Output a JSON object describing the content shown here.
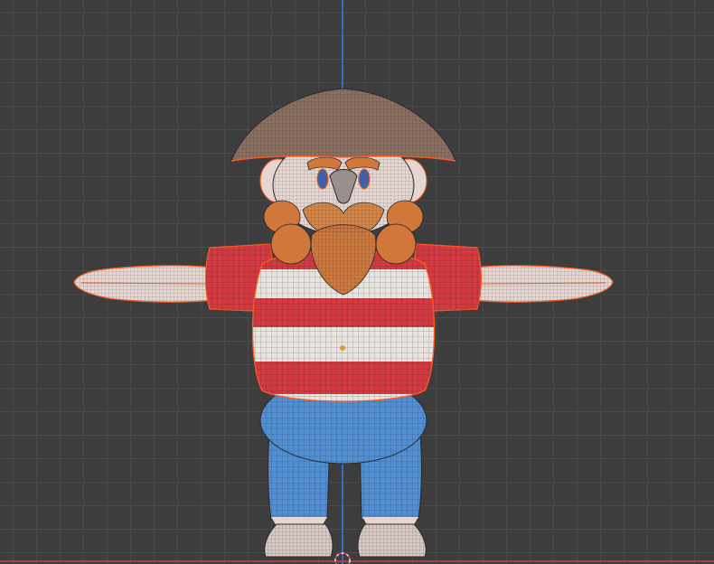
{
  "viewport": {
    "view": "front-orthographic",
    "mode": "edit-wireframe-overlay",
    "axis_colors": {
      "z": "#3b6ec8",
      "x": "#b84545"
    },
    "grid_color": "#4a4a4a",
    "background": "#3d3d3d"
  },
  "model": {
    "subject": "cartoon-pirate-character",
    "pose": "t-pose",
    "colors": {
      "hat": "#8a6e60",
      "skin": "#e6d6d2",
      "beard": "#d2773a",
      "shirt_red": "#d6383e",
      "shirt_white": "#e8e4df",
      "pants": "#4f8fd6",
      "selection": "#ff5a1f",
      "wire": "#2a2a2a"
    }
  }
}
